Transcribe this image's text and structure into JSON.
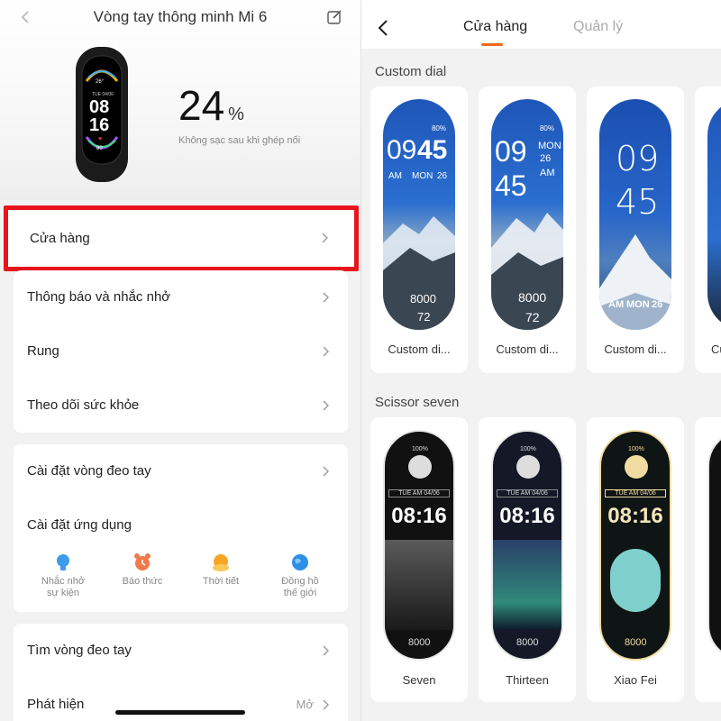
{
  "left": {
    "title": "Vòng tay thông minh Mi 6",
    "battery": {
      "value": "24",
      "unit": "%",
      "note": "Không sạc sau khi ghép nối"
    },
    "band_face": {
      "temp": "26°",
      "date": "TUE 04/06",
      "hour": "08",
      "minute": "16",
      "heart": "80"
    },
    "menu_store": "Cửa hàng",
    "menu_group1": [
      {
        "label": "Thông báo và nhắc nhở"
      },
      {
        "label": "Rung"
      },
      {
        "label": "Theo dõi sức khỏe"
      }
    ],
    "menu_band_settings": "Cài đặt vòng đeo tay",
    "menu_app_settings": "Cài đặt ứng dụng",
    "apps": [
      {
        "label1": "Nhắc nhở",
        "label2": "sự kiện",
        "icon": "bulb-icon",
        "color": "#3d9be9"
      },
      {
        "label1": "Báo thức",
        "label2": "",
        "icon": "alarm-icon",
        "color": "#f07a4a"
      },
      {
        "label1": "Thời tiết",
        "label2": "",
        "icon": "weather-icon",
        "color": "#f6a623"
      },
      {
        "label1": "Đồng hồ",
        "label2": "thế giới",
        "icon": "globe-icon",
        "color": "#2f8fe8"
      }
    ],
    "menu_find_band": "Tìm vòng đeo tay",
    "menu_discover": "Phát hiện",
    "menu_discover_value": "Mở"
  },
  "right": {
    "tabs": {
      "store": "Cửa hàng",
      "manage": "Quản lý"
    },
    "accent": "#f06a1a",
    "section1": "Custom dial",
    "section2": "Scissor seven",
    "custom_dials": [
      {
        "name": "Custom di...",
        "time_a": "09",
        "time_b": "45",
        "ampm": "AM",
        "day": "MON",
        "date": "26",
        "steps": "8000",
        "heart": "72",
        "battery": "80%"
      },
      {
        "name": "Custom di...",
        "time_a": "09",
        "time_b": "45",
        "ampm": "AM",
        "day": "MON",
        "date": "26",
        "steps": "8000",
        "heart": "72",
        "battery": "80%"
      },
      {
        "name": "Custom di...",
        "time_a": "09",
        "time_b": "45",
        "ampm": "AM",
        "day": "MON",
        "date": "26"
      },
      {
        "name": "Cu"
      }
    ],
    "scissor_dials": [
      {
        "name": "Seven",
        "time": "08:16",
        "date": "TUE AM 04/06",
        "battery": "100%",
        "steps": "8000",
        "frame": "#e9e9e9"
      },
      {
        "name": "Thirteen",
        "time": "08:16",
        "date": "TUE AM 04/06",
        "battery": "100%",
        "steps": "8000",
        "frame": "#e9e9e9"
      },
      {
        "name": "Xiao Fei",
        "time": "08:16",
        "date": "TUE AM 04/06",
        "battery": "100%",
        "steps": "8000",
        "frame": "#f0dca0"
      },
      {
        "name": ""
      }
    ]
  }
}
